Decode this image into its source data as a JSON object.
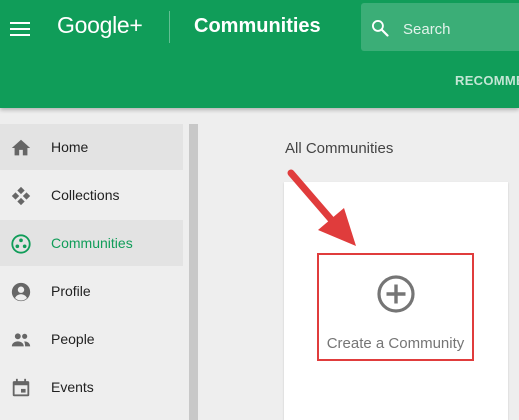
{
  "header": {
    "menu_icon": "hamburger-menu-icon",
    "logo": "Google+",
    "title": "Communities",
    "search": {
      "placeholder": "Search",
      "icon": "search-icon"
    },
    "tabs": [
      {
        "label": "RECOMME"
      }
    ],
    "background": "#109d59"
  },
  "sidebar": {
    "items": [
      {
        "label": "Home",
        "icon": "home-icon",
        "active": false
      },
      {
        "label": "Collections",
        "icon": "collections-icon",
        "active": false
      },
      {
        "label": "Communities",
        "icon": "communities-icon",
        "active": true
      },
      {
        "label": "Profile",
        "icon": "profile-icon",
        "active": false
      },
      {
        "label": "People",
        "icon": "people-icon",
        "active": false
      },
      {
        "label": "Events",
        "icon": "events-icon",
        "active": false
      }
    ],
    "active_color": "#109d59"
  },
  "main": {
    "section_title": "All Communities",
    "create_card": {
      "label": "Create a Community",
      "icon": "plus-circle-icon"
    },
    "highlight_color": "#e03c3c",
    "annotation": "red-arrow-icon"
  }
}
